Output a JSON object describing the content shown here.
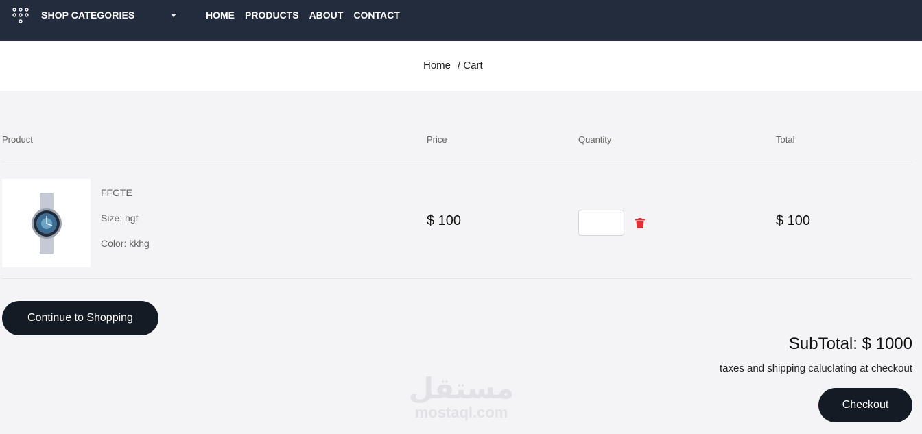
{
  "header": {
    "categories_label": "SHOP CATEGORIES",
    "nav": [
      "HOME",
      "PRODUCTS",
      "ABOUT",
      "CONTACT"
    ]
  },
  "breadcrumb": {
    "home": "Home",
    "current": "/ Cart"
  },
  "table": {
    "headers": {
      "product": "Product",
      "price": "Price",
      "quantity": "Quantity",
      "total": "Total"
    },
    "row": {
      "name": "FFGTE",
      "size": "Size: hgf",
      "color": "Color: kkhg",
      "price": "$ 100",
      "quantity": "",
      "total": "$ 100"
    }
  },
  "actions": {
    "continue_label": "Continue to Shopping",
    "checkout_label": "Checkout"
  },
  "summary": {
    "subtotal": "SubTotal: $ 1000",
    "taxes_note": "taxes and shipping caluclating at checkout"
  },
  "watermark": {
    "arabic": "مستقل",
    "latin": "mostaql.com"
  },
  "colors": {
    "topbar": "#232c3c",
    "button": "#151b24",
    "trash": "#e0303a"
  }
}
